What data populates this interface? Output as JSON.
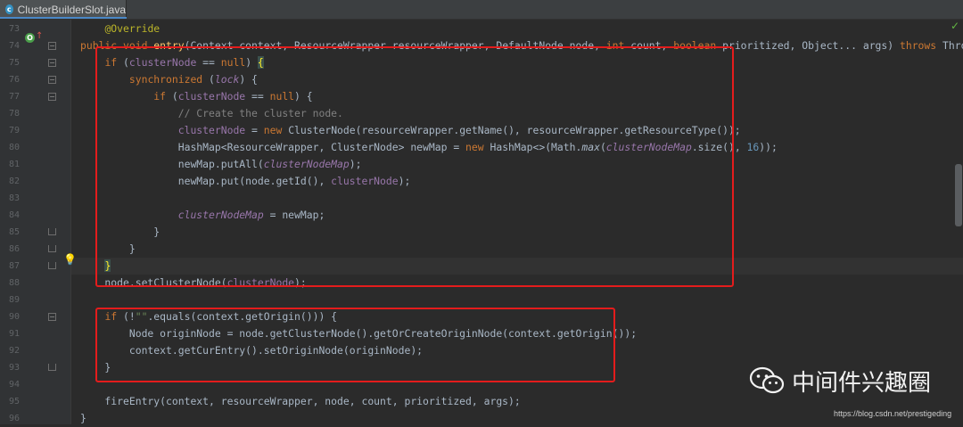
{
  "tab": {
    "label": "ClusterBuilderSlot.java",
    "icon": "java-class-icon",
    "icon_letter": "c"
  },
  "line_numbers": [
    "73",
    "74",
    "75",
    "76",
    "77",
    "78",
    "79",
    "80",
    "81",
    "82",
    "83",
    "84",
    "85",
    "86",
    "87",
    "88",
    "89",
    "90",
    "91",
    "92",
    "93",
    "94",
    "95",
    "96"
  ],
  "code_lines": [
    [
      {
        "t": "    ",
        "c": ""
      },
      {
        "t": "@Override",
        "c": "ann"
      }
    ],
    [
      {
        "t": "public void ",
        "c": "kw"
      },
      {
        "t": "entry",
        "c": "fn"
      },
      {
        "t": "(Context context, ResourceWrapper resourceWrapper, DefaultNode node, ",
        "c": ""
      },
      {
        "t": "int ",
        "c": "kw"
      },
      {
        "t": "count, ",
        "c": ""
      },
      {
        "t": "boolean ",
        "c": "kw"
      },
      {
        "t": "prioritized, Object... args) ",
        "c": ""
      },
      {
        "t": "throws ",
        "c": "kw"
      },
      {
        "t": "Throwable {",
        "c": ""
      }
    ],
    [
      {
        "t": "    ",
        "c": ""
      },
      {
        "t": "if ",
        "c": "kw"
      },
      {
        "t": "(",
        "c": ""
      },
      {
        "t": "clusterNode",
        "c": "fld"
      },
      {
        "t": " == ",
        "c": ""
      },
      {
        "t": "null",
        "c": "kw"
      },
      {
        "t": ") ",
        "c": ""
      },
      {
        "t": "{",
        "c": "brace-hl"
      }
    ],
    [
      {
        "t": "        ",
        "c": ""
      },
      {
        "t": "synchronized ",
        "c": "kw"
      },
      {
        "t": "(",
        "c": ""
      },
      {
        "t": "lock",
        "c": "fldi"
      },
      {
        "t": ") {",
        "c": ""
      }
    ],
    [
      {
        "t": "            ",
        "c": ""
      },
      {
        "t": "if ",
        "c": "kw"
      },
      {
        "t": "(",
        "c": ""
      },
      {
        "t": "clusterNode",
        "c": "fld"
      },
      {
        "t": " == ",
        "c": ""
      },
      {
        "t": "null",
        "c": "kw"
      },
      {
        "t": ") {",
        "c": ""
      }
    ],
    [
      {
        "t": "                ",
        "c": ""
      },
      {
        "t": "// Create the cluster node.",
        "c": "cmt"
      }
    ],
    [
      {
        "t": "                ",
        "c": ""
      },
      {
        "t": "clusterNode",
        "c": "fld"
      },
      {
        "t": " = ",
        "c": ""
      },
      {
        "t": "new ",
        "c": "kw"
      },
      {
        "t": "ClusterNode(resourceWrapper.getName(), resourceWrapper.getResourceType());",
        "c": ""
      }
    ],
    [
      {
        "t": "                HashMap<ResourceWrapper, ClusterNode> newMap = ",
        "c": ""
      },
      {
        "t": "new ",
        "c": "kw"
      },
      {
        "t": "HashMap<>(Math.",
        "c": ""
      },
      {
        "t": "max",
        "c": "ital"
      },
      {
        "t": "(",
        "c": ""
      },
      {
        "t": "clusterNodeMap",
        "c": "fldi"
      },
      {
        "t": ".size(), ",
        "c": ""
      },
      {
        "t": "16",
        "c": "num"
      },
      {
        "t": "));",
        "c": ""
      }
    ],
    [
      {
        "t": "                newMap.putAll(",
        "c": ""
      },
      {
        "t": "clusterNodeMap",
        "c": "fldi"
      },
      {
        "t": ");",
        "c": ""
      }
    ],
    [
      {
        "t": "                newMap.put(node.getId(), ",
        "c": ""
      },
      {
        "t": "clusterNode",
        "c": "fld"
      },
      {
        "t": ");",
        "c": ""
      }
    ],
    [
      {
        "t": "",
        "c": ""
      }
    ],
    [
      {
        "t": "                ",
        "c": ""
      },
      {
        "t": "clusterNodeMap",
        "c": "fldi"
      },
      {
        "t": " = newMap;",
        "c": ""
      }
    ],
    [
      {
        "t": "            }",
        "c": ""
      }
    ],
    [
      {
        "t": "        }",
        "c": ""
      }
    ],
    [
      {
        "t": "    ",
        "c": ""
      },
      {
        "t": "}",
        "c": "brace-hl"
      }
    ],
    [
      {
        "t": "    node.setClusterNode(",
        "c": ""
      },
      {
        "t": "clusterNode",
        "c": "fld"
      },
      {
        "t": ");",
        "c": ""
      }
    ],
    [
      {
        "t": "",
        "c": ""
      }
    ],
    [
      {
        "t": "    ",
        "c": ""
      },
      {
        "t": "if ",
        "c": "kw"
      },
      {
        "t": "(!",
        "c": ""
      },
      {
        "t": "\"\"",
        "c": "str"
      },
      {
        "t": ".equals(context.getOrigin())) {",
        "c": ""
      }
    ],
    [
      {
        "t": "        Node originNode = node.getClusterNode().getOrCreateOriginNode(context.getOrigin());",
        "c": ""
      }
    ],
    [
      {
        "t": "        context.getCurEntry().setOriginNode(originNode);",
        "c": ""
      }
    ],
    [
      {
        "t": "    }",
        "c": ""
      }
    ],
    [
      {
        "t": "",
        "c": ""
      }
    ],
    [
      {
        "t": "    fireEntry(context, resourceWrapper, node, count, prioritized, args);",
        "c": ""
      }
    ],
    [
      {
        "t": "}",
        "c": ""
      }
    ]
  ],
  "icons": {
    "override": "override-method-icon",
    "bulb": "intention-bulb-icon",
    "check": "inspection-ok-icon"
  },
  "colors": {
    "highlight_box": "#e41c1c",
    "keyword": "#cc7832",
    "field": "#9876aa",
    "background": "#2b2b2b"
  },
  "watermark": {
    "text": "中间件兴趣圈",
    "url": "https://blog.csdn.net/prestigeding"
  }
}
